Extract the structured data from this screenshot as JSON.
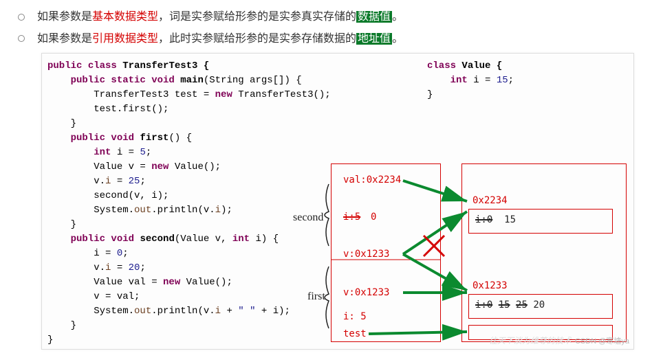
{
  "bullets": {
    "line1": {
      "pre": "如果参数是",
      "red": "基本数据类型",
      "mid": "，词是实参赋给形参的是实参真实存储的",
      "hl": "数据值",
      "post": "。"
    },
    "line2": {
      "pre": "如果参数是",
      "red": "引用数据类型",
      "mid": "，此时实参赋给形参的是实参存储数据的",
      "hl": "地址值",
      "post": "。"
    }
  },
  "code_main": {
    "l1a": "public",
    "l1b": " class ",
    "l1c": "TransferTest3 {",
    "l2a": "    public",
    "l2b": " static void ",
    "l2c": "main",
    "l2d": "(String args[]) {",
    "l3a": "        TransferTest3 test = ",
    "l3b": "new",
    "l3c": " TransferTest3();",
    "l4": "        test.first();",
    "l5": "    }",
    "l6a": "    public",
    "l6b": " void ",
    "l6c": "first",
    "l6d": "() {",
    "l7a": "        int",
    "l7b": " i = ",
    "l7c": "5",
    "l7d": ";",
    "l8a": "        Value v = ",
    "l8b": "new",
    "l8c": " Value();",
    "l9a": "        v.",
    "l9b": "i",
    "l9c": " = ",
    "l9d": "25",
    "l9e": ";",
    "l10": "        second(v, i);",
    "l11a": "        System.",
    "l11b": "out",
    "l11c": ".println(v.",
    "l11d": "i",
    "l11e": ");",
    "l12": "    }",
    "l13a": "    public",
    "l13b": " void ",
    "l13c": "second",
    "l13d": "(Value v, ",
    "l13e": "int",
    "l13f": " i) {",
    "l14a": "        i = ",
    "l14b": "0",
    "l14c": ";",
    "l15a": "        v.",
    "l15b": "i",
    "l15c": " = ",
    "l15d": "20",
    "l15e": ";",
    "l16a": "        Value val = ",
    "l16b": "new",
    "l16c": " Value();",
    "l17": "        v = val;",
    "l18a": "        System.",
    "l18b": "out",
    "l18c": ".println(v.",
    "l18d": "i",
    "l18e": " + ",
    "l18f": "\" \"",
    "l18g": " + i);",
    "l19": "    }",
    "l20": "}"
  },
  "code_value": {
    "l1a": "class",
    "l1b": " Value {",
    "l2a": "    int",
    "l2b": " i = ",
    "l2c": "15",
    "l2d": ";",
    "l3": "}"
  },
  "diagram": {
    "second_label": "second",
    "first_label": "first",
    "val": "val:0x2234",
    "i5strike": "i:5",
    "i_zero": "0",
    "v_second": "v:0x1233",
    "v_first": "v:0x1233",
    "i_first": "i:  5",
    "test": "test",
    "addr2234": "0x2234",
    "obj2234_i": "i:0",
    "obj2234_15": "15",
    "addr1233": "0x1233",
    "obj1233_i": "i:0",
    "obj1233_15": "15",
    "obj1233_25": "25",
    "obj1233_20": "20"
  },
  "watermark": "CSDN @寒塘ya",
  "watermark2": "往天下淡为维尊的技术"
}
